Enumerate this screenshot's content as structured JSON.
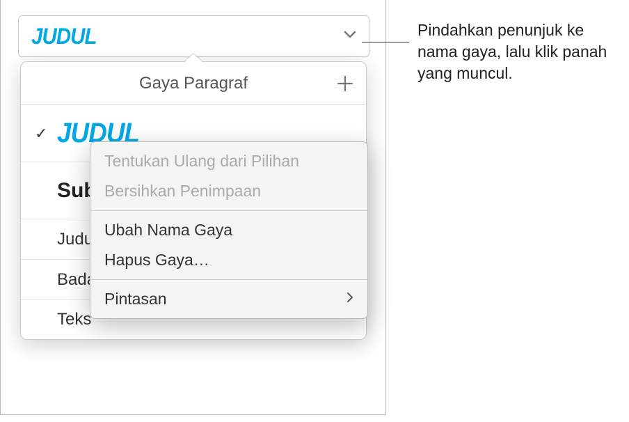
{
  "style_button": {
    "label": "JUDUL"
  },
  "popover": {
    "title": "Gaya Paragraf",
    "styles": [
      {
        "label": "JUDUL",
        "checked": true,
        "kind": "judul"
      },
      {
        "label": "Subjudul",
        "checked": false,
        "kind": "sub"
      },
      {
        "label": "Judul",
        "checked": false,
        "kind": "plain"
      },
      {
        "label": "Badan",
        "checked": false,
        "kind": "plain"
      },
      {
        "label": "Teks",
        "checked": false,
        "kind": "plain"
      }
    ]
  },
  "context_menu": {
    "redefine": "Tentukan Ulang dari Pilihan",
    "clear": "Bersihkan Penimpaan",
    "rename": "Ubah Nama Gaya",
    "delete": "Hapus Gaya…",
    "shortcut": "Pintasan"
  },
  "callout": {
    "text": "Pindahkan penunjuk ke nama gaya, lalu klik panah yang muncul."
  }
}
